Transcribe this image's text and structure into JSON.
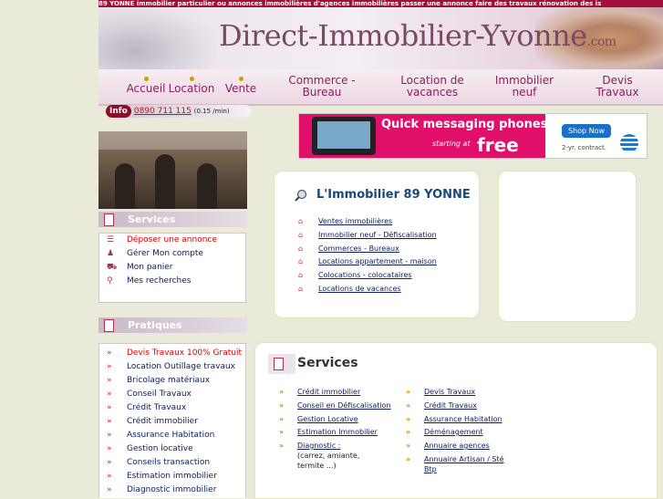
{
  "topbar_text": "89 YONNE immobilier particulier ou annonces immobilières d'agences immobilières passer une annonce faire des travaux rénovation des is",
  "logo": {
    "main": "Direct-Immobilier-Yvonne",
    "suffix": ".com"
  },
  "nav": [
    "Accueil",
    "Location",
    "Vente",
    "Commerce -\nBureau",
    "Location de\nvacances",
    "Immobilier\nneuf",
    "Devis\nTravaux"
  ],
  "phone": {
    "badge": "Info",
    "number": "0890 711 115",
    "tarif": "(0.15 /min)"
  },
  "ad": {
    "headline": "Quick messaging phones",
    "starting": "starting at",
    "price": "free",
    "cta": "Shop Now",
    "contract": "2-yr. contract."
  },
  "sidebar": {
    "services_title": "Services",
    "services_items": [
      {
        "label": "Déposer une annonce",
        "icon": "list-icon",
        "red": true
      },
      {
        "label": "Gérer Mon compte",
        "icon": "user-icon",
        "red": false
      },
      {
        "label": "Mon panier",
        "icon": "cart-icon",
        "red": false
      },
      {
        "label": "Mes recherches",
        "icon": "search-icon",
        "red": false
      }
    ],
    "pratiques_title": "Pratiques",
    "pratiques_items": [
      {
        "label": "Devis Travaux 100% Gratuit",
        "red": true
      },
      {
        "label": "Location Outillage travaux",
        "red": false
      },
      {
        "label": "Bricolage matériaux",
        "red": false
      },
      {
        "label": "Conseil Travaux",
        "red": false
      },
      {
        "label": "Crédit Travaux",
        "red": false
      },
      {
        "label": "Crédit immobilier",
        "red": false
      },
      {
        "label": "Assurance Habitation",
        "red": false
      },
      {
        "label": "Gestion locative",
        "red": false
      },
      {
        "label": "Conseils transaction",
        "red": false
      },
      {
        "label": "Estimation immobilier",
        "red": false
      },
      {
        "label": "Diagnostic immobilier",
        "red": false
      }
    ]
  },
  "main": {
    "title": "L'Immobilier 89 YONNE",
    "links": [
      "Ventes immobilières",
      "Immobilier neuf - Défiscalisation",
      "Commerces - Bureaux",
      "Locations appartement - maison",
      "Colocations - colocataires",
      "Locations de vacances"
    ]
  },
  "services": {
    "title": "Services",
    "left": [
      "Crédit immobilier",
      "Conseil en Défiscalisation",
      "Gestion Locative",
      "Estimation Immobilier",
      "Diagnostic :"
    ],
    "diag_note": "(carrez, amiante,\ntermite ...)",
    "right": [
      "Devis Travaux",
      "Crédit Travaux",
      "Assurance Habitation",
      "Déménagement",
      "Annuaire agences",
      "Annuaire Artisan / Sté\nBtp"
    ]
  }
}
